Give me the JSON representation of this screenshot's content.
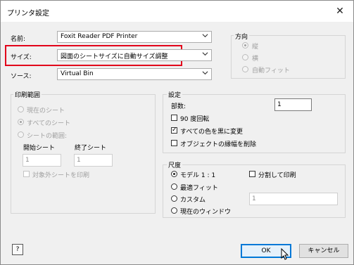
{
  "window": {
    "title": "プリンタ設定",
    "close_glyph": "✕"
  },
  "name_row": {
    "label": "名前:",
    "value": "Foxit Reader PDF Printer"
  },
  "size_row": {
    "label": "サイズ:",
    "value": "図面のシートサイズに自動サイズ調整"
  },
  "source_row": {
    "label": "ソース:",
    "value": "Virtual Bin"
  },
  "orientation": {
    "title": "方向",
    "options": [
      "縦",
      "横",
      "自動フィット"
    ],
    "selected_index": 0,
    "enabled": false
  },
  "print_range": {
    "title": "印刷範囲",
    "options": [
      "現在のシート",
      "すべてのシート",
      "シートの範囲:"
    ],
    "selected_index": 1,
    "enabled": false,
    "start_label": "開始シート",
    "start_value": "1",
    "end_label": "終了シート",
    "end_value": "1",
    "exclude_label": "対象外シートを印刷"
  },
  "settings": {
    "title": "設定",
    "copies_label": "部数:",
    "copies_value": "1",
    "rotate_label": "90 度回転",
    "rotate_checked": false,
    "black_label": "すべての色を黒に変更",
    "black_checked": true,
    "delete_border_label": "オブジェクトの縁幅を削除",
    "delete_border_checked": false
  },
  "scale": {
    "title": "尺度",
    "options": [
      "モデル 1 : 1",
      "最適フィット",
      "カスタム",
      "現在のウィンドウ"
    ],
    "selected_index": 0,
    "split_label": "分割して印刷",
    "split_checked": false,
    "custom_value": "1"
  },
  "buttons": {
    "help": "?",
    "ok": "OK",
    "cancel": "キャンセル"
  },
  "colors": {
    "highlight": "#e2001a",
    "primary_border": "#0078d7"
  }
}
